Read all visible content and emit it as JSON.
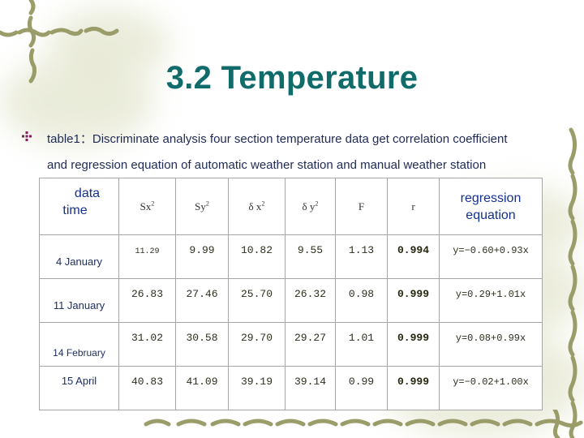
{
  "slide": {
    "title": "3.2 Temperature",
    "bullet_icon": "diamond-bullet-icon",
    "caption_line1": "table1：Discriminate analysis four section temperature data get correlation coefficient",
    "caption_line2": "and regression equation of automatic weather station and manual weather station",
    "colors": {
      "title": "#116b6b",
      "caption": "#1f2a55",
      "header_blue": "#13318f",
      "bullet": "#8b1a5a",
      "decoration": "#9a9c6a"
    }
  },
  "table": {
    "headers": {
      "data_time_line1": "data",
      "data_time_line2": "time",
      "sx2_base": "Sx",
      "sx2_sup": "2",
      "sy2_base": "Sy",
      "sy2_sup": "2",
      "dx2_base": "δ x",
      "dx2_sup": "2",
      "dy2_base": "δ y",
      "dy2_sup": "2",
      "f": "F",
      "r": "r",
      "regression_line1": "regression",
      "regression_line2": "equation"
    },
    "rows": [
      {
        "date": "4 January",
        "sx2": "11.29",
        "sy2": "9.99",
        "dx2": "10.82",
        "dy2": "9.55",
        "f": "1.13",
        "r": "0.994",
        "equation": "y=−0.60+0.93x"
      },
      {
        "date": "11 January",
        "sx2": "26.83",
        "sy2": "27.46",
        "dx2": "25.70",
        "dy2": "26.32",
        "f": "0.98",
        "r": "0.999",
        "equation": "y=0.29+1.01x"
      },
      {
        "date": "14  February",
        "sx2": "31.02",
        "sy2": "30.58",
        "dx2": "29.70",
        "dy2": "29.27",
        "f": "1.01",
        "r": "0.999",
        "equation": "y=0.08+0.99x"
      },
      {
        "date": "15 April",
        "sx2": "40.83",
        "sy2": "41.09",
        "dx2": "39.19",
        "dy2": "39.14",
        "f": "0.99",
        "r": "0.999",
        "equation": "y=−0.02+1.00x"
      }
    ]
  }
}
